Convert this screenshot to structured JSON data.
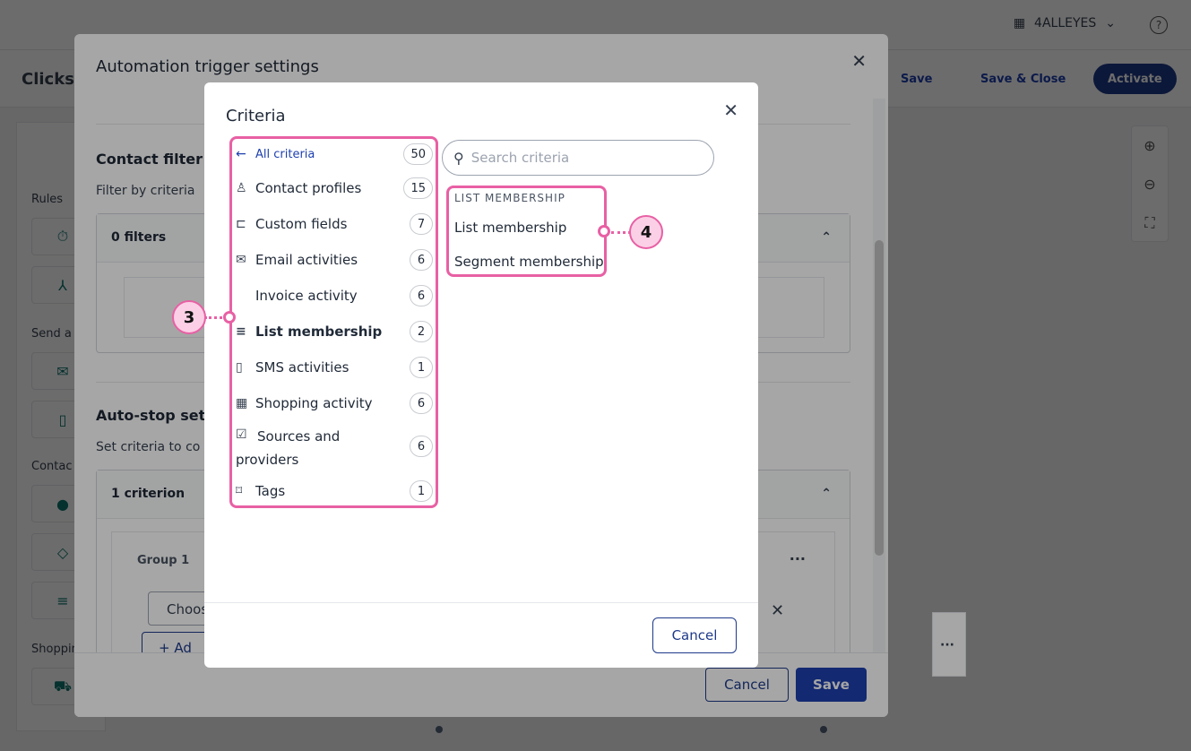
{
  "app": {
    "org_name": "4ALLEYES",
    "help": "?",
    "page_title": "Clicks t",
    "save": "Save",
    "save_close": "Save & Close",
    "activate": "Activate",
    "left_panel": {
      "rules": "Rules",
      "send": "Send a",
      "contact": "Contac",
      "shopping": "Shoppin"
    }
  },
  "trigger_modal": {
    "title": "Automation trigger settings",
    "contact_filter_heading": "Contact filter",
    "contact_filter_desc": "Filter by criteria",
    "filters_count": "0 filters",
    "autostop_heading": "Auto-stop setti",
    "autostop_desc": "Set criteria to co",
    "criterion_count": "1 criterion",
    "group_label": "Group 1",
    "choose_placeholder": "Choos",
    "add_label": "+ Ad",
    "cancel": "Cancel",
    "save": "Save"
  },
  "criteria_modal": {
    "title": "Criteria",
    "search_placeholder": "Search criteria",
    "all_criteria": {
      "label": "All criteria",
      "count": "50"
    },
    "categories": [
      {
        "label": "Contact profiles",
        "count": "15",
        "icon": "person-icon"
      },
      {
        "label": "Custom fields",
        "count": "7",
        "icon": "custom-fields-icon"
      },
      {
        "label": "Email activities",
        "count": "6",
        "icon": "envelope-icon"
      },
      {
        "label": "Invoice activity",
        "count": "6",
        "icon": ""
      },
      {
        "label": "List membership",
        "count": "2",
        "icon": "list-icon"
      },
      {
        "label": "SMS activities",
        "count": "1",
        "icon": "phone-icon"
      },
      {
        "label": "Shopping activity",
        "count": "6",
        "icon": "store-icon"
      },
      {
        "label": "Sources and providers",
        "count": "6",
        "icon": "clipboard-check-icon"
      },
      {
        "label": "Tags",
        "count": "1",
        "icon": "bookmark-icon"
      }
    ],
    "subcategory_heading": "LIST MEMBERSHIP",
    "subcategory_items": [
      "List membership",
      "Segment membership"
    ],
    "cancel": "Cancel"
  },
  "annotations": {
    "callout_3": "3",
    "callout_4": "4"
  },
  "colors": {
    "highlight": "#e860a4",
    "primary": "#1e40af",
    "teal_icon": "#0f766e"
  }
}
